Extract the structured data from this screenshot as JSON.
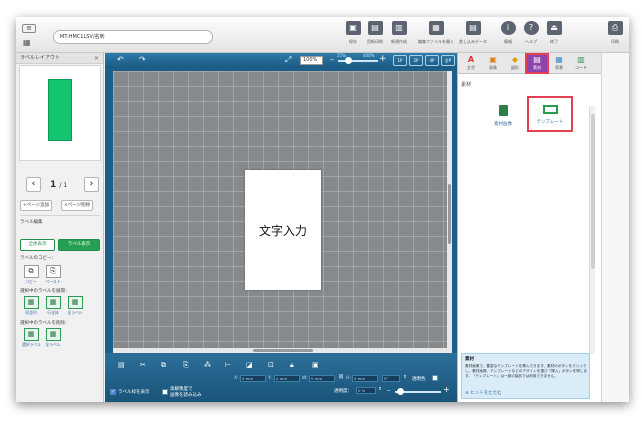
{
  "app": {
    "file_name": "MT-HMC1LSV/名刺"
  },
  "toolbar": [
    {
      "icon": "save-icon",
      "label": "保存"
    },
    {
      "icon": "preview-icon",
      "label": "用紙印刷"
    },
    {
      "icon": "new-icon",
      "label": "新規作成"
    },
    {
      "icon": "open-icon",
      "label": "編集ファイルを開く"
    },
    {
      "icon": "data-icon",
      "label": "差し込みデータ"
    },
    {
      "icon": "info-icon",
      "label": "情報"
    },
    {
      "icon": "help-icon",
      "label": "ヘルプ"
    },
    {
      "icon": "exit-icon",
      "label": "終了"
    },
    {
      "icon": "print-icon",
      "label": "印刷"
    }
  ],
  "left_panel": {
    "title": "ラベルレイアウト",
    "page_current": "1",
    "page_total": "/ 1",
    "add_page": "+ページ追加",
    "delete_page": "×ページ削除",
    "label_edit": "ラベル編集",
    "show_all": "全体表示",
    "show_label": "ラベル表示",
    "copy_heading": "ラベルのコピー：",
    "copy_label": "コピー",
    "paste_label": "ペースト",
    "expand_heading": "選択中のラベルを展開：",
    "expand_items": [
      "同並列",
      "行全体",
      "全ラベル"
    ],
    "delete_heading": "選択中のラベルを削除：",
    "delete_items": [
      "選択ラベル",
      "全ラベル"
    ]
  },
  "workspace": {
    "zoom": "100%",
    "zoom_min": "25%",
    "zoom_max": "400%",
    "label_text": "文字入力",
    "view_buttons": [
      "1P",
      "2P",
      "4P",
      "全P"
    ]
  },
  "edit_bar": {
    "x_label": "X:",
    "x_value": "0 mm",
    "y_label": "Y:",
    "y_value": "0 mm",
    "w_label": "W:",
    "w_value": "0 mm",
    "h_label": "H:",
    "h_value": "0 mm",
    "rotation_value": "0°",
    "transparent_label": "透明色",
    "show_frame": "ラベル枠を表示",
    "high_res": "高解像度で",
    "high_res2": "画像を読み込み",
    "opacity_label": "透明度：",
    "opacity_value": "0 %"
  },
  "right_panel": {
    "tabs": [
      "文字",
      "画像",
      "図形",
      "素材",
      "背景",
      "コード"
    ],
    "active_tab": "素材",
    "section_title": "素材",
    "tiles": [
      {
        "label": "素材画像"
      },
      {
        "label": "テンプレート"
      }
    ],
    "hint_title": "素材",
    "hint_body": "素材画像で、豊富なテンプレートを挿入できます。素材のボタンをクリックし、素材画像、テンプレートなどのデザインを選び「挿入」ボタンを押します。「テンプレート」は一部の製品では利用できません。",
    "hint_toggle": "ヒントをたたむ"
  },
  "colors": {
    "accent": "#1e5f8a",
    "label_green": "#14c470",
    "highlight": "#e34050",
    "active_tab": "#8e44ad"
  }
}
